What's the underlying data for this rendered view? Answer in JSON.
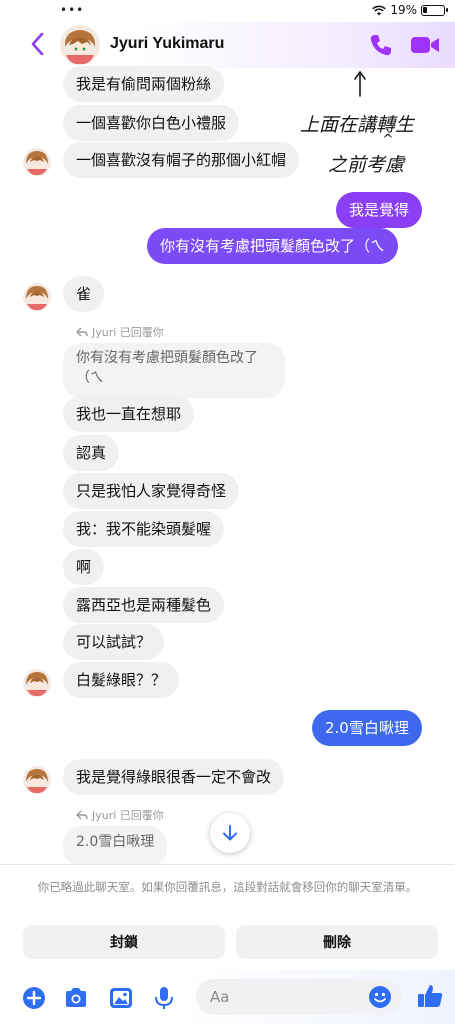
{
  "status": {
    "battery_text": "19%"
  },
  "header": {
    "name": "Jyuri Yukimaru"
  },
  "annotation": {
    "line1": "上面在講轉生",
    "caret": "^",
    "line2": "之前考慮"
  },
  "messages": {
    "m1": "我是有偷問兩個粉絲",
    "m2": "一個喜歡你白色小禮服",
    "m3": "一個喜歡沒有帽子的那個小紅帽",
    "m4": "我是覺得",
    "m5": "你有沒有考慮把頭髮顏色改了（ㄟ",
    "m6": "雀",
    "reply1_note": "Jyuri 已回覆你",
    "reply1_quote": "你有沒有考慮把頭髮顏色改了（ㄟ",
    "m7": "我也一直在想耶",
    "m8": "認真",
    "m9": "只是我怕人家覺得奇怪",
    "m10": "我：我不能染頭髮喔",
    "m11": "啊",
    "m12": "露西亞也是兩種髮色",
    "m13": "可以試試？",
    "m14": "白髮綠眼？？",
    "m15": "2.0雪白啾理",
    "m16": "我是覺得綠眼很香一定不會改",
    "reply2_note": "Jyuri 已回覆你",
    "reply2_quote": "2.0雪白啾理"
  },
  "notice": {
    "text": "你已略過此聊天室。如果你回覆訊息，這段對話就會移回你的聊天室清單。",
    "block_label": "封鎖",
    "delete_label": "刪除"
  },
  "composer": {
    "placeholder": "Aa"
  },
  "colors": {
    "accent": "#8a3ff5",
    "blue": "#3f68f0",
    "icon_purple": "#a033ff",
    "icon_blue": "#2f6df5"
  }
}
